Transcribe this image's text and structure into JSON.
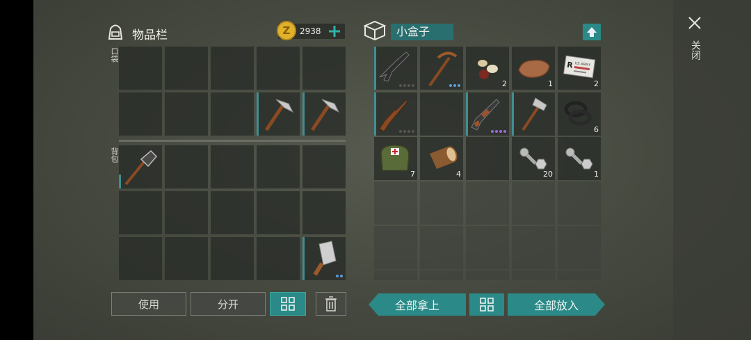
{
  "inventory": {
    "title": "物品栏",
    "coins": "2938",
    "pocket_label": "口袋",
    "backpack_label": "背包",
    "pocket_slots": [
      "",
      "",
      "",
      "",
      "",
      "",
      "",
      "",
      "pickaxe-hammer",
      "pickaxe-hammer"
    ],
    "backpack_slots": [
      "shovel",
      "",
      "",
      "",
      "",
      "",
      "",
      "",
      "",
      "",
      "",
      "",
      "",
      "",
      "cleaver"
    ],
    "cleaver_quality_dots": 2
  },
  "container": {
    "title": "小盒子",
    "items": [
      {
        "icon": "assault-rifle-icon",
        "count": "",
        "dots": "4 grey"
      },
      {
        "icon": "pickaxe-icon",
        "count": "",
        "dots": "3 blue"
      },
      {
        "icon": "seeds-icon",
        "count": "2"
      },
      {
        "icon": "iron-ore-icon",
        "count": "1"
      },
      {
        "icon": "army-id-card-icon",
        "count": "2"
      },
      {
        "icon": "hunting-rifle-icon",
        "count": "",
        "dots": "4 grey"
      },
      {
        "icon": "empty",
        "count": ""
      },
      {
        "icon": "ak-rifle-icon",
        "count": "",
        "dots": "4 purple"
      },
      {
        "icon": "hatchet-icon",
        "count": ""
      },
      {
        "icon": "rubber-rings-icon",
        "count": "6"
      },
      {
        "icon": "medkit-bag-icon",
        "count": "7"
      },
      {
        "icon": "log-icon",
        "count": "4"
      },
      {
        "icon": "empty",
        "count": ""
      },
      {
        "icon": "bolts-icon",
        "count": "20"
      },
      {
        "icon": "bolts-icon",
        "count": "1"
      }
    ],
    "id_card_text": "US ARMY"
  },
  "buttons": {
    "use": "使用",
    "split": "分开",
    "take_all": "全部拿上",
    "put_all": "全部放入"
  },
  "close_label": "关闭",
  "colors": {
    "accent": "#2b8a87",
    "slot_bar": "#3f8f93",
    "coin": "#e0b22c"
  }
}
